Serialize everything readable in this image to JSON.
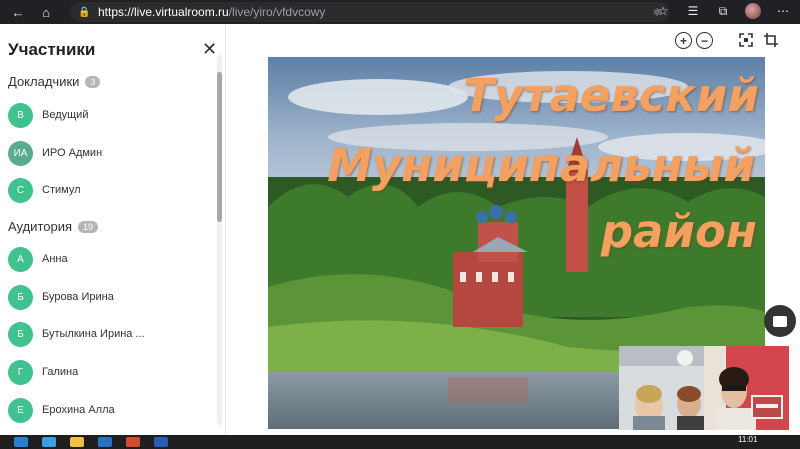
{
  "browser": {
    "url_host": "https://live.virtualroom.ru",
    "url_path": "/live/yiro/vfdvcowy"
  },
  "sidebar": {
    "title": "Участники",
    "speakers": {
      "label": "Докладчики",
      "count": "3",
      "items": [
        {
          "initials": "В",
          "name": "Ведущий"
        },
        {
          "initials": "ИА",
          "name": "ИРО Админ"
        },
        {
          "initials": "С",
          "name": "Стимул"
        }
      ]
    },
    "audience": {
      "label": "Аудитория",
      "count": "19",
      "items": [
        {
          "initials": "А",
          "name": "Анна"
        },
        {
          "initials": "Б",
          "name": "Бурова Ирина"
        },
        {
          "initials": "Б",
          "name": "Бутылкина Ирина ..."
        },
        {
          "initials": "Г",
          "name": "Галина"
        },
        {
          "initials": "Е",
          "name": "Ерохина Алла"
        }
      ]
    }
  },
  "slide": {
    "line1": "Тутаевский",
    "line2": "Муниципальный",
    "line3": "район"
  },
  "taskbar": {
    "time": "11:01"
  },
  "colors": {
    "avatar": "#3fc28f",
    "title_text": "#f3a060"
  }
}
